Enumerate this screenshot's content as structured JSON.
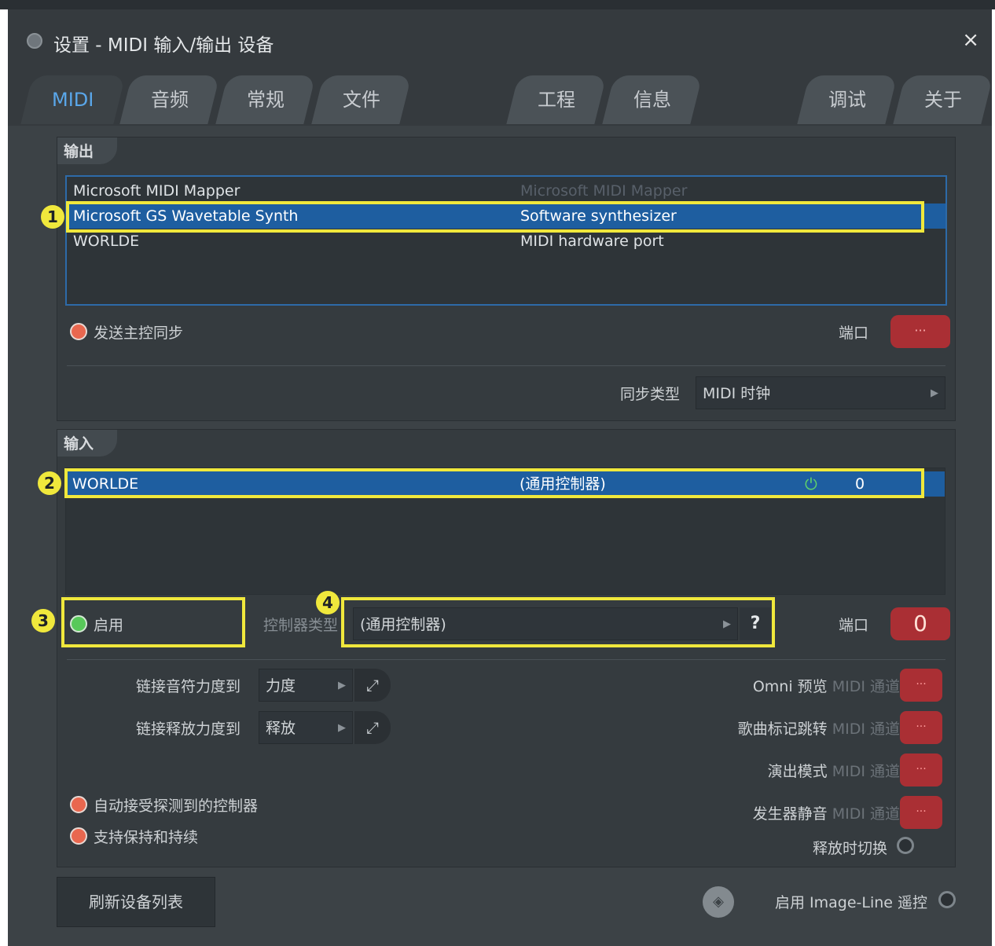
{
  "window": {
    "title": "设置 - MIDI 输入/输出 设备",
    "close": "×"
  },
  "tabs": [
    "MIDI",
    "音频",
    "常规",
    "文件",
    "工程",
    "信息",
    "调试",
    "关于"
  ],
  "output": {
    "label": "输出",
    "devices": [
      {
        "name": "Microsoft MIDI Mapper",
        "type": "Microsoft MIDI Mapper",
        "selected": false
      },
      {
        "name": "Microsoft GS Wavetable Synth",
        "type": "Software synthesizer",
        "selected": true
      },
      {
        "name": "WORLDE",
        "type": "MIDI hardware port",
        "selected": false
      }
    ],
    "send_master_sync": "发送主控同步",
    "port_label": "端口",
    "port_value": "···",
    "sync_type_label": "同步类型",
    "sync_type_value": "MIDI 时钟"
  },
  "input": {
    "label": "输入",
    "devices": [
      {
        "name": "WORLDE",
        "type": "(通用控制器)",
        "channel": "0",
        "selected": true
      }
    ],
    "enable_label": "启用",
    "controller_type_label": "控制器类型",
    "controller_type_value": "(通用控制器)",
    "help": "?",
    "port_label": "端口",
    "port_value": "0",
    "link_velocity_label": "链接音符力度到",
    "link_velocity_value": "力度",
    "link_release_label": "链接释放力度到",
    "link_release_value": "释放",
    "auto_accept": "自动接受探测到的控制器",
    "sustain_support": "支持保持和持续",
    "omni_preview": {
      "label": "Omni 预览",
      "suffix": "MIDI 通道",
      "value": "···"
    },
    "song_marker_jump": {
      "label": "歌曲标记跳转",
      "suffix": "MIDI 通道",
      "value": "···"
    },
    "performance_mode": {
      "label": "演出模式",
      "suffix": "MIDI 通道",
      "value": "···"
    },
    "generator_mute": {
      "label": "发生器静音",
      "suffix": "MIDI 通道",
      "value": "···"
    },
    "toggle_on_release": "释放时切换"
  },
  "footer": {
    "refresh_button": "刷新设备列表",
    "imageline_remote": "启用 Image-Line 遥控"
  },
  "annotations": [
    "1",
    "2",
    "3",
    "4"
  ],
  "colors": {
    "highlight": "#f0e83c",
    "selection": "#1e5ea0",
    "accent_red": "#aa2f34",
    "tab_active": "#5aa7ea"
  }
}
